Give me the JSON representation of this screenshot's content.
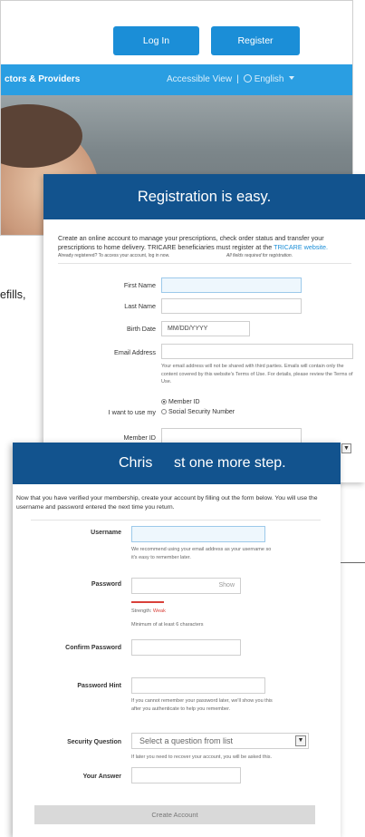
{
  "site": {
    "login_label": "Log In",
    "register_label": "Register",
    "nav_left": "ctors & Providers",
    "accessible_view": "Accessible View",
    "separator": "|",
    "language": "English",
    "body_fragment": "efills,"
  },
  "registration": {
    "title": "Registration is easy.",
    "intro_text": "Create an online account to manage your prescriptions, check order status and transfer your prescriptions to home delivery. TRICARE beneficiaries must register at the ",
    "intro_link": "TRICARE website.",
    "already_registered": "Already registered? To access your account, log in now.",
    "required_note": "All fields required for registration.",
    "fields": {
      "first_name": "First Name",
      "last_name": "Last Name",
      "birth_date": "Birth Date",
      "birth_date_placeholder": "MM/DD/YYYY",
      "email": "Email Address",
      "email_help": "Your email address will not be shared with third parties. Emails will contain only the content covered by this website's Terms of Use. For details, please review the Terms of Use.",
      "use_my": "I want to use my",
      "member_id_option": "Member ID",
      "ssn_option": "Social Security Number",
      "member_id": "Member ID"
    }
  },
  "account": {
    "title_part1": "Chris",
    "title_part2": "st one more step.",
    "intro_text": "Now that you have verified your membership, create your account by filling out the form below. You will use the username and password entered the next time you return.",
    "fields": {
      "username": "Username",
      "username_help": "We recommend using your email address as your username so it's easy to remember later.",
      "password": "Password",
      "password_show": "Show",
      "strength_label": "Strength:",
      "strength_value": "Weak",
      "password_min": "Minimum of at least 6 characters",
      "confirm_password": "Confirm Password",
      "password_hint": "Password Hint",
      "hint_help": "If you cannot remember your password later, we'll show you this after you authenticate to help you remember.",
      "security_question": "Security Question",
      "security_placeholder": "Select a question from list",
      "security_help": "If later you need to recover your account, you will be asked this.",
      "your_answer": "Your Answer"
    },
    "create_label": "Create Account"
  },
  "colors": {
    "header_blue": "#12538e",
    "nav_blue": "#2a9ee2",
    "button_blue": "#1b8ed7",
    "weak_red": "#d9413a"
  }
}
